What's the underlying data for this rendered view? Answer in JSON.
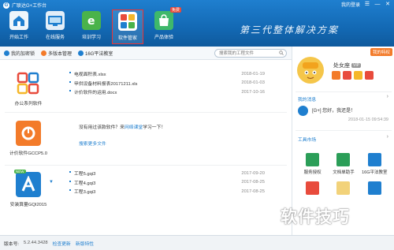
{
  "window": {
    "title": "广联达G+工作台",
    "login_label": "我的登录",
    "controls": [
      "☰",
      "—",
      "✕"
    ]
  },
  "nav": {
    "items": [
      {
        "label": "开始工作",
        "icon": "home-icon",
        "color": "#eef6fb"
      },
      {
        "label": "在线服务",
        "icon": "online-service-icon",
        "color": "#e3eef8"
      },
      {
        "label": "培训学习",
        "icon": "training-icon",
        "color": "#4ab34a"
      },
      {
        "label": "软件管家",
        "icon": "software-manager-icon",
        "color": "#ffffff"
      },
      {
        "label": "产品体验",
        "icon": "product-bag-icon",
        "color": "#3fb86b",
        "badge": "免费"
      }
    ]
  },
  "slogan": "第三代整体解决方案",
  "toolbar": {
    "items": [
      {
        "label": "我的加密锁",
        "color": "#1f7fcf"
      },
      {
        "label": "多版本管理",
        "color": "#f37b2a"
      },
      {
        "label": "16G平法教室",
        "color": "#1f7fcf"
      }
    ],
    "search_placeholder": "搜索我的工程文件"
  },
  "sections": [
    {
      "app_name": "办公系列软件",
      "files": [
        {
          "name": "电视面积表.xlsx",
          "date": "2018-01-19"
        },
        {
          "name": "甲供设备材料报表20171211.xls",
          "date": "2018-01-03"
        },
        {
          "name": "计价软件的运用.docx",
          "date": "2017-10-16"
        }
      ]
    },
    {
      "app_name": "计价软件GCCP5.0",
      "empty_prefix": "没有用过该款软件？来",
      "empty_link": "网络课堂",
      "empty_suffix": "学习一下！",
      "search_more": "搜索更多文件"
    },
    {
      "app_name": "安装算量GQI2015",
      "new_badge": "NEW",
      "files": [
        {
          "name": "工程5.gqi3",
          "date": "2017-09-20"
        },
        {
          "name": "工程4.gqi3",
          "date": "2017-08-25"
        },
        {
          "name": "工程3.gqi3",
          "date": "2017-08-25"
        }
      ]
    }
  ],
  "right_panel": {
    "special_label": "我的特权",
    "username": "处女座",
    "vip": "VIP",
    "messages_title": "我的消息",
    "message": "[G+] 您好，我还是！",
    "message_time": "2018-01-15 09:54:39",
    "tools_title": "工具市场",
    "tools": [
      {
        "label": "服务授权",
        "color": "#2b9e58"
      },
      {
        "label": "文档单助手",
        "color": "#2b9e58"
      },
      {
        "label": "16G平法教室",
        "color": "#1f7fcf"
      },
      {
        "label": "",
        "color": "#e84b3c"
      },
      {
        "label": "",
        "color": "#f2d27a"
      },
      {
        "label": "",
        "color": "#1f7fcf"
      }
    ]
  },
  "status": {
    "version_label": "版本号:",
    "version": "5.2.44.3428",
    "link1": "检查更新",
    "link2": "新版特性"
  },
  "watermark": "软件技巧"
}
